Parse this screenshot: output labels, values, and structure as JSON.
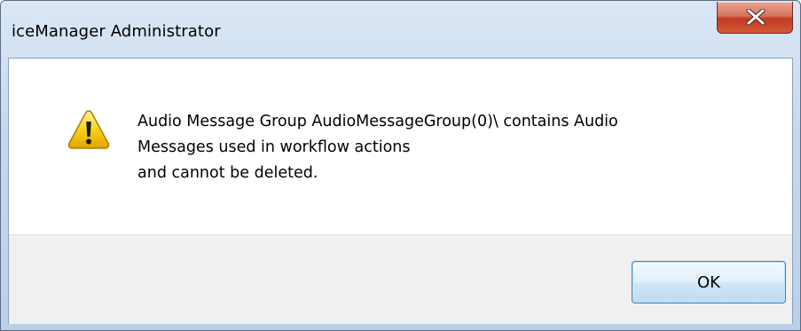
{
  "window": {
    "title": "iceManager Administrator",
    "close_icon": "close-x-icon"
  },
  "dialog": {
    "icon": "warning-icon",
    "message_lines": [
      "Audio Message Group AudioMessageGroup(0)\\ contains Audio",
      "Messages used in workflow actions",
      "and cannot be deleted."
    ],
    "ok_label": "OK"
  },
  "colors": {
    "close_button": "#c7462b",
    "ok_button_border": "#3c7fb1",
    "footer_background": "#f0f0f0",
    "warning_yellow": "#f5c400"
  }
}
